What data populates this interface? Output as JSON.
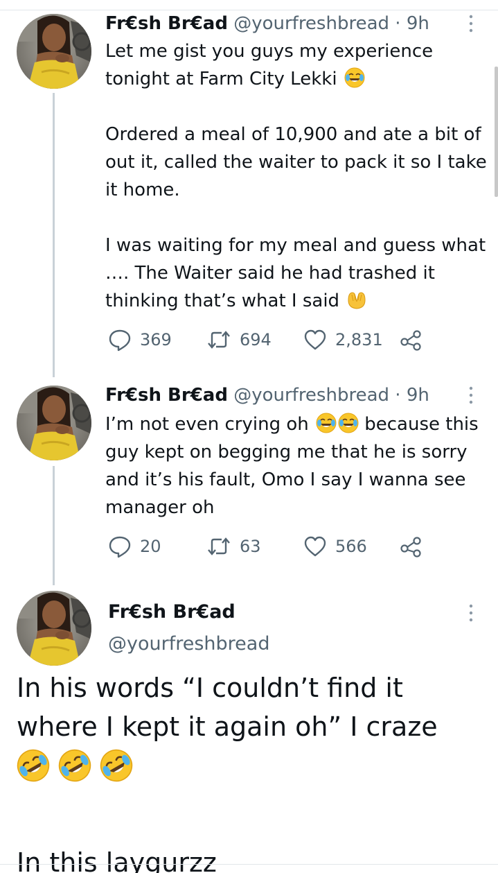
{
  "tweets": [
    {
      "name": "Fr€sh Br€ad",
      "handle": "@yourfreshbread",
      "separator": "·",
      "time": "9h",
      "paragraphs": [
        "Let me gist you guys my experience tonight at Farm City Lekki",
        "Ordered a meal of 10,900 and ate a bit of out it, called the waiter to pack it so I take it home.",
        "I was waiting for my meal and guess what …. The Waiter said he had trashed it thinking that’s what I said"
      ],
      "replies": "369",
      "retweets": "694",
      "likes": "2,831"
    },
    {
      "name": "Fr€sh Br€ad",
      "handle": "@yourfreshbread",
      "separator": "·",
      "time": "9h",
      "text_before_emoji": "I’m not even crying oh",
      "text_after_emoji": "because this guy kept on begging me that he is sorry and it’s his fault, Omo I say I wanna see manager oh",
      "replies": "20",
      "retweets": "63",
      "likes": "566"
    }
  ],
  "main_tweet": {
    "name": "Fr€sh Br€ad",
    "handle": "@yourfreshbread",
    "line1": "In his words “I couldn’t find it where I kept it again oh” I craze",
    "line2": "In this laygurzz"
  },
  "icons": {
    "reply": "speech-bubble-icon",
    "retweet": "retweet-arrows-icon",
    "like": "heart-outline-icon",
    "share": "share-nodes-icon",
    "more": "vertical-dots-icon",
    "emoji_laugh": "face-with-tears-of-joy",
    "emoji_hands": "palms-up-together",
    "emoji_rofl": "rolling-on-the-floor-laughing"
  },
  "colors": {
    "text": "#0f1419",
    "secondary": "#536471",
    "thread_line": "#c9d1d7"
  }
}
